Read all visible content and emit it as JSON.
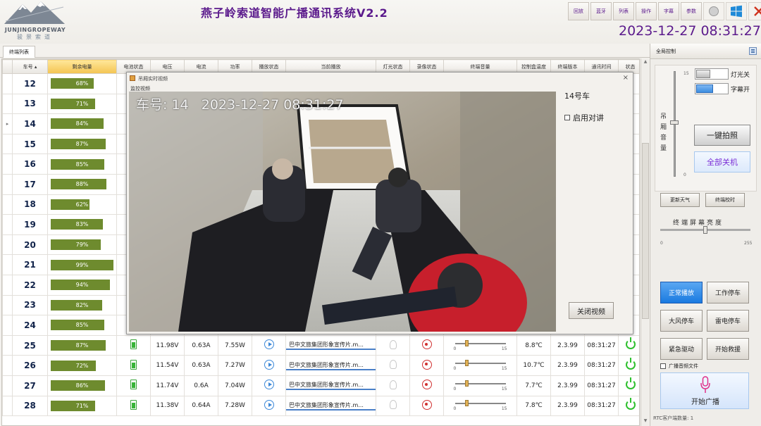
{
  "app": {
    "title": "燕子岭索道智能广播通讯系统V2.2",
    "logo_en": "JUNJINGROPEWAY",
    "logo_cn": "骏景索道",
    "clock": "2023-12-27 08:31:27"
  },
  "toolbar": {
    "buttons": [
      "回放",
      "蓝牙",
      "列表",
      "操作",
      "字幕",
      "参数"
    ],
    "icons": [
      "circle-icon",
      "windows-icon",
      "close-icon"
    ],
    "close_color": "#d0331e"
  },
  "tabs": {
    "terminals": "终端列表"
  },
  "table": {
    "headers": [
      "车号",
      "剩余电量",
      "电池状态",
      "电压",
      "电流",
      "功率",
      "播放状态",
      "当前播放",
      "灯光状态",
      "录像状态",
      "终端音量",
      "控制盒温度",
      "终端版本",
      "通讯时间",
      "状态"
    ],
    "rows": [
      {
        "car": "12",
        "battery": "68%",
        "battery_level": 0.68
      },
      {
        "car": "13",
        "battery": "71%",
        "battery_level": 0.71
      },
      {
        "car": "14",
        "battery": "84%",
        "battery_level": 0.84,
        "selected": true
      },
      {
        "car": "15",
        "battery": "87%",
        "battery_level": 0.87
      },
      {
        "car": "16",
        "battery": "85%",
        "battery_level": 0.85
      },
      {
        "car": "17",
        "battery": "88%",
        "battery_level": 0.88
      },
      {
        "car": "18",
        "battery": "62%",
        "battery_level": 0.62
      },
      {
        "car": "19",
        "battery": "83%",
        "battery_level": 0.83
      },
      {
        "car": "20",
        "battery": "79%",
        "battery_level": 0.79
      },
      {
        "car": "21",
        "battery": "99%",
        "battery_level": 0.99
      },
      {
        "car": "22",
        "battery": "94%",
        "battery_level": 0.94
      },
      {
        "car": "23",
        "battery": "82%",
        "battery_level": 0.82
      },
      {
        "car": "24",
        "battery": "85%",
        "battery_level": 0.85
      },
      {
        "car": "25",
        "battery": "87%",
        "battery_level": 0.87,
        "voltage": "11.98V",
        "current": "0.63A",
        "power": "7.55W",
        "playing": "巴中文旅集团形象宣传片.m...",
        "vol_level": 0.2,
        "vol_min": "0",
        "vol_max": "15",
        "temp": "8.8℃",
        "version": "2.3.99",
        "time": "08:31:27"
      },
      {
        "car": "26",
        "battery": "72%",
        "battery_level": 0.72,
        "voltage": "11.54V",
        "current": "0.63A",
        "power": "7.27W",
        "playing": "巴中文旅集团形象宣传片.m...",
        "vol_level": 0.2,
        "vol_min": "0",
        "vol_max": "15",
        "temp": "10.7℃",
        "version": "2.3.99",
        "time": "08:31:27"
      },
      {
        "car": "27",
        "battery": "86%",
        "battery_level": 0.86,
        "voltage": "11.74V",
        "current": "0.6A",
        "power": "7.04W",
        "playing": "巴中文旅集团形象宣传片.m...",
        "vol_level": 0.2,
        "vol_min": "0",
        "vol_max": "15",
        "temp": "7.7℃",
        "version": "2.3.99",
        "time": "08:31:27"
      },
      {
        "car": "28",
        "battery": "71%",
        "battery_level": 0.71,
        "voltage": "11.38V",
        "current": "0.64A",
        "power": "7.28W",
        "playing": "巴中文旅集团形象宣传片.m...",
        "vol_level": 0.2,
        "vol_min": "0",
        "vol_max": "15",
        "temp": "7.8℃",
        "version": "2.3.99",
        "time": "08:31:27"
      }
    ],
    "battery_color": "#6e8b2e",
    "status_color": "#2ec02e"
  },
  "popup": {
    "title": "吊厢实时视频",
    "subtitle": "监控视频",
    "osd": "车号: 14   2023-12-27 08:31:27",
    "camera_label": "14号车",
    "intercom_label": "启用对讲",
    "close_button": "关闭视频"
  },
  "panel": {
    "title": "全局控制",
    "volume_label": "吊厢音量",
    "volume_max": "15",
    "volume_min": "0",
    "volume_level": 0.5,
    "light_label": "灯光关",
    "subtitle_label": "字幕开",
    "snapshot_button": "一键拍照",
    "shutdown_button": "全部关机",
    "update_weather": "更新天气",
    "terminal_calibrate": "终端校时",
    "brightness_label": "终端屏幕亮度",
    "brightness_min": "0",
    "brightness_max": "255",
    "brightness_level": 0.5,
    "mode_buttons": [
      "正常播放",
      "工作停车",
      "大风停车",
      "雷电停车",
      "紧急驱动",
      "开始救援"
    ],
    "active_mode": "正常播放",
    "broadcast_files": "广播音频文件",
    "broadcast_button": "开始广播",
    "rtc_count": "RTC客户端数量: 1"
  },
  "colors": {
    "accent": "#5b1a8c",
    "active_blue": "#1a7ae0",
    "record_red": "#d03030",
    "play_blue": "#3c88d8"
  }
}
